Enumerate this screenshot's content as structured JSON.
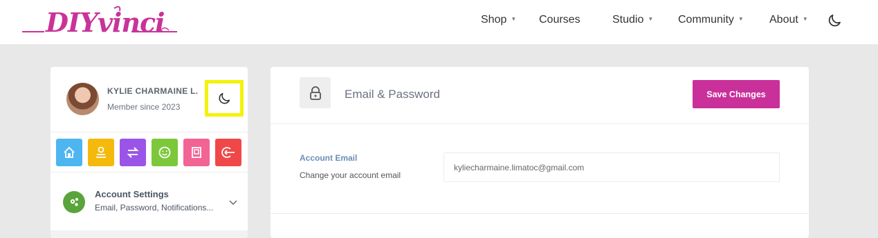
{
  "brand": {
    "logo_text": "DIYvinci",
    "accent": "#c9309a",
    "background": "#e8e8e8"
  },
  "nav": {
    "items": [
      {
        "label": "Shop",
        "has_dropdown": true
      },
      {
        "label": "Courses",
        "has_dropdown": false
      },
      {
        "label": "Studio",
        "has_dropdown": true
      },
      {
        "label": "Community",
        "has_dropdown": true
      },
      {
        "label": "About",
        "has_dropdown": true
      }
    ],
    "theme_icon": "moon-icon"
  },
  "profile": {
    "name": "KYLIE CHARMAINE L.",
    "member_since": "Member since 2023",
    "dark_mode_icon": "moon-icon",
    "highlight_color": "#f5f20a"
  },
  "quick_actions": [
    {
      "icon": "home-icon",
      "color": "#4db6f0"
    },
    {
      "icon": "user-icon",
      "color": "#f5b90c"
    },
    {
      "icon": "swap-icon",
      "color": "#9a55e8"
    },
    {
      "icon": "smile-icon",
      "color": "#7cc83a"
    },
    {
      "icon": "frame-icon",
      "color": "#f26494"
    },
    {
      "icon": "logout-icon",
      "color": "#f04848"
    }
  ],
  "sidebar": {
    "account_settings_title": "Account Settings",
    "account_settings_sub": "Email, Password, Notifications..."
  },
  "main": {
    "section_title": "Email & Password",
    "save_label": "Save Changes",
    "account_email_label": "Account Email",
    "account_email_help": "Change your account email",
    "email_value": "kyliecharmaine.limatoc@gmail.com"
  }
}
